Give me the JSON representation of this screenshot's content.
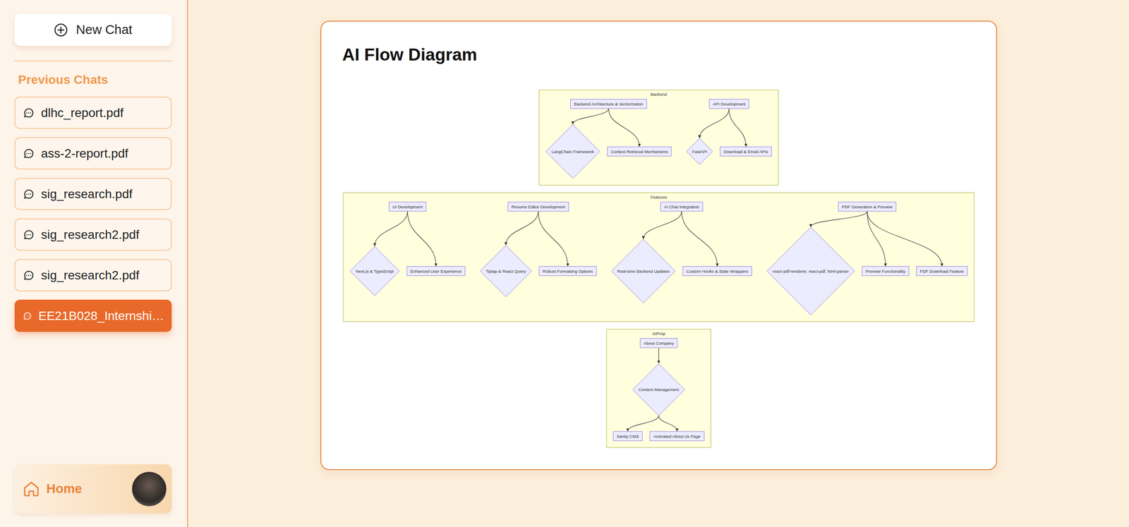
{
  "sidebar": {
    "new_chat": "New Chat",
    "section_title": "Previous Chats",
    "chats": [
      {
        "label": "dlhc_report.pdf",
        "selected": false
      },
      {
        "label": "ass-2-report.pdf",
        "selected": false
      },
      {
        "label": "sig_research.pdf",
        "selected": false
      },
      {
        "label": "sig_research2.pdf",
        "selected": false
      },
      {
        "label": "sig_research2.pdf",
        "selected": false
      },
      {
        "label": "EE21B028_Internshi…",
        "selected": true
      }
    ],
    "home": "Home"
  },
  "diagram": {
    "title": "AI Flow Diagram",
    "groups": [
      {
        "label": "Backend",
        "trees": [
          {
            "label": "Backend Architecture & Vectorization",
            "kind": "box",
            "children": [
              {
                "label": "LangChain Framework",
                "kind": "diamond",
                "children": []
              },
              {
                "label": "Context Retrieval Mechanisms",
                "kind": "box",
                "children": []
              }
            ]
          },
          {
            "label": "API Development",
            "kind": "box",
            "children": [
              {
                "label": "FastAPI",
                "kind": "diamond",
                "children": []
              },
              {
                "label": "Download & Email APIs",
                "kind": "box",
                "children": []
              }
            ]
          }
        ]
      },
      {
        "label": "Features",
        "trees": [
          {
            "label": "UI Development",
            "kind": "box",
            "children": [
              {
                "label": "Next.js & TypeScript",
                "kind": "diamond",
                "children": []
              },
              {
                "label": "Enhanced User Experience",
                "kind": "box",
                "children": []
              }
            ]
          },
          {
            "label": "Resume Editor Development",
            "kind": "box",
            "children": [
              {
                "label": "Tiptap & React Query",
                "kind": "diamond",
                "children": []
              },
              {
                "label": "Robust Formatting Options",
                "kind": "box",
                "children": []
              }
            ]
          },
          {
            "label": "AI Chat Integration",
            "kind": "box",
            "children": [
              {
                "label": "Real-time Backend Updates",
                "kind": "diamond",
                "children": []
              },
              {
                "label": "Custom Hooks & State Wrappers",
                "kind": "box",
                "children": []
              }
            ]
          },
          {
            "label": "PDF Generation & Preview",
            "kind": "box",
            "children": [
              {
                "label": "react-pdf-renderer, react-pdf, html-parser",
                "kind": "diamond",
                "children": []
              },
              {
                "label": "Preview Functionality",
                "kind": "box",
                "children": []
              },
              {
                "label": "PDF Download Feature",
                "kind": "box",
                "children": []
              }
            ]
          }
        ]
      },
      {
        "label": "JoPrep",
        "trees": [
          {
            "label": "About Company",
            "kind": "box",
            "children": [
              {
                "label": "Content Management",
                "kind": "diamond",
                "children": [
                  {
                    "label": "Sanity CMS",
                    "kind": "box",
                    "children": []
                  },
                  {
                    "label": "Animated About Us Page",
                    "kind": "box",
                    "children": []
                  }
                ]
              }
            ]
          }
        ]
      }
    ]
  }
}
